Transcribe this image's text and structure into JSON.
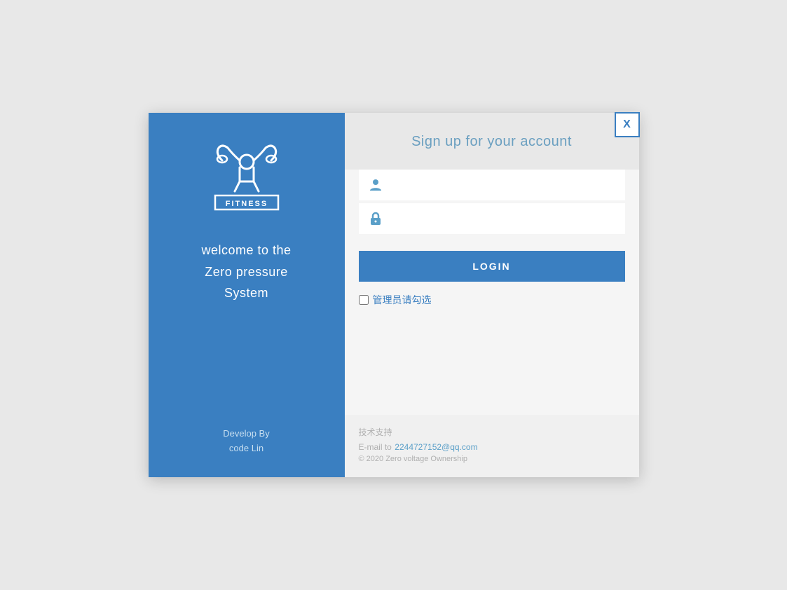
{
  "modal": {
    "close_label": "X"
  },
  "left_panel": {
    "welcome_line1": "welcome to the",
    "welcome_line2": "Zero pressure",
    "welcome_line3": "System",
    "develop_line1": "Develop By",
    "develop_line2": "code Lin"
  },
  "right_panel": {
    "title": "Sign up for your account",
    "username_placeholder": "",
    "password_placeholder": "",
    "login_button": "LOGIN",
    "admin_checkbox_label": "管理员请勾选",
    "tech_support_label": "技术支持",
    "email_label": "E-mail to",
    "email_address": "2244727152@qq.com",
    "copyright": "© 2020  Zero voltage Ownership"
  },
  "icons": {
    "user_icon": "👤",
    "lock_icon": "🔒"
  }
}
